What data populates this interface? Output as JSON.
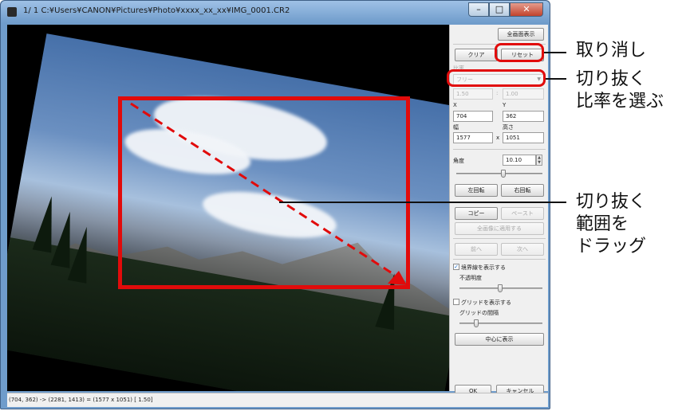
{
  "window": {
    "title": "1/ 1  C:¥Users¥CANON¥Pictures¥Photo¥xxxx_xx_xx¥IMG_0001.CR2",
    "controls": {
      "minimize": "–",
      "maximize": "□",
      "close": "✕"
    }
  },
  "panel": {
    "fullscreen_button": "全画面表示",
    "clear_button": "クリア",
    "reset_button": "リセット",
    "ratio_label": "比率",
    "ratio_select": "フリー",
    "ratio_w": "1.50",
    "ratio_sep": ":",
    "ratio_h": "1.00",
    "x_label": "X",
    "y_label": "Y",
    "x_value": "704",
    "y_value": "362",
    "width_label": "幅",
    "height_label": "高さ",
    "width_value": "1577",
    "times": "x",
    "height_value": "1051",
    "angle_label": "角度",
    "angle_value": "10.10",
    "rotate_left": "左回転",
    "rotate_right": "右回転",
    "copy_button": "コピー",
    "paste_button": "ペースト",
    "apply_all_button": "全画像に適用する",
    "prev_button": "前へ",
    "next_button": "次へ",
    "show_border_label": "境界線を表示する",
    "opacity_label": "不透明度",
    "show_grid_label": "グリッドを表示する",
    "grid_spacing_label": "グリッドの間隔",
    "center_button": "中心に表示",
    "ok_button": "OK",
    "cancel_button": "キャンセル"
  },
  "status": "(704,  362) -> (2281, 1413) = (1577 x 1051) [ 1.50]",
  "annotations": {
    "reset": "取り消し",
    "ratio": "切り抜く\n比率を選ぶ",
    "drag": "切り抜く\n範囲を\nドラッグ"
  },
  "colors": {
    "highlight": "#e10b0b",
    "titlebar": "#6f9ccb"
  }
}
